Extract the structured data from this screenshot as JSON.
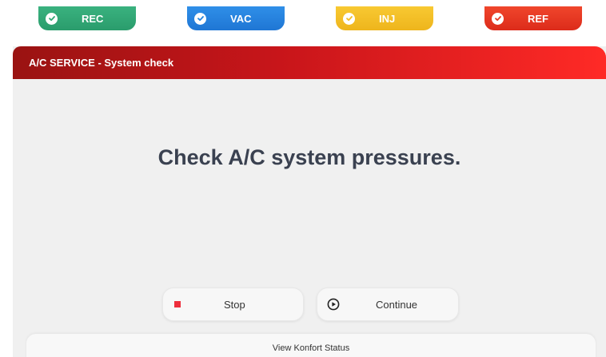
{
  "steps": [
    {
      "label": "REC",
      "color": "#2fa673",
      "status_icon": "check-icon"
    },
    {
      "label": "VAC",
      "color": "#2584de",
      "status_icon": "check-icon"
    },
    {
      "label": "INJ",
      "color": "#f3be25",
      "status_icon": "check-icon"
    },
    {
      "label": "REF",
      "color": "#e63a24",
      "status_icon": "check-icon"
    }
  ],
  "panel": {
    "title": "A/C SERVICE - System check",
    "message": "Check A/C system pressures."
  },
  "actions": {
    "stop_label": "Stop",
    "stop_icon": "stop-icon",
    "continue_label": "Continue",
    "continue_icon": "play-circle-icon"
  },
  "footer": {
    "status_link": "View Konfort Status"
  },
  "colors": {
    "header_red": "#c8151a",
    "stop_red": "#ee2e3c",
    "text_dark": "#3a4150"
  }
}
